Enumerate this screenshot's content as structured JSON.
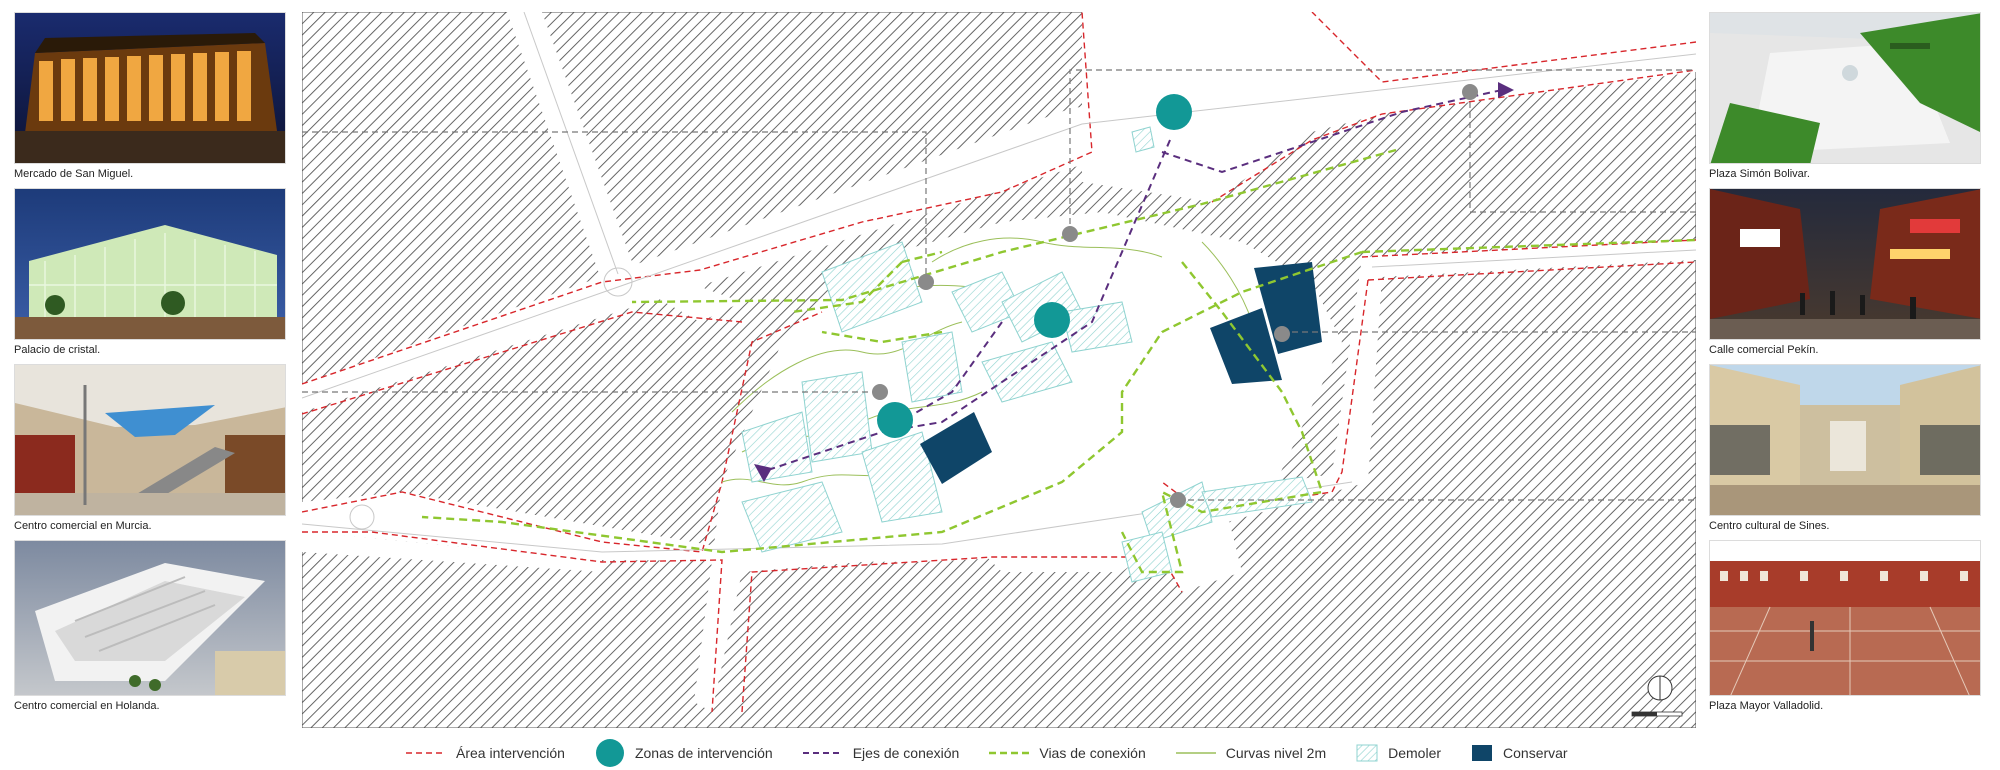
{
  "photos_left": [
    {
      "caption": "Mercado de San Miguel."
    },
    {
      "caption": "Palacio de cristal."
    },
    {
      "caption": "Centro comercial en Murcia."
    },
    {
      "caption": "Centro comercial en Holanda."
    }
  ],
  "photos_right": [
    {
      "caption": "Plaza Simón Bolivar."
    },
    {
      "caption": "Calle comercial Pekín."
    },
    {
      "caption": "Centro cultural de Sines."
    },
    {
      "caption": "Plaza Mayor Valladolid."
    }
  ],
  "legend": {
    "area": "Área intervención",
    "zonas": "Zonas de intervención",
    "ejes": "Ejes de conexión",
    "vias": "Vias de conexión",
    "curvas": "Curvas nivel 2m",
    "demoler": "Demoler",
    "conservar": "Conservar"
  },
  "colors": {
    "area_boundary": "#d8262b",
    "zone_circle": "#129896",
    "axis": "#5a2e7e",
    "vias": "#8fc730",
    "contour": "#9bbf5a",
    "demoler": "#8fd3d0",
    "conservar": "#0f4568",
    "hatch": "#4a4a4a",
    "marker": "#8a8a8a"
  },
  "icons": {
    "north": "north-arrow-icon",
    "scale": "scale-bar-icon"
  }
}
